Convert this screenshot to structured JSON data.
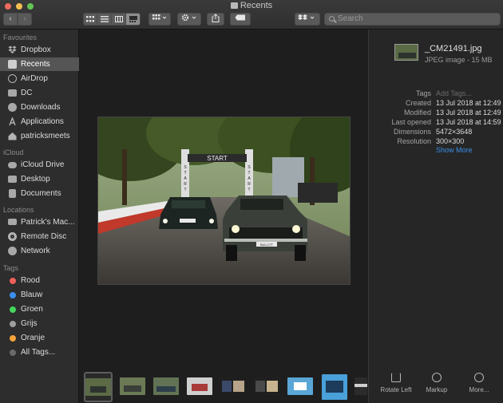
{
  "window": {
    "title": "Recents"
  },
  "toolbar": {
    "back_icon": "chevron-left-icon",
    "forward_icon": "chevron-right-icon",
    "view_modes": [
      "icon-view",
      "list-view",
      "column-view",
      "gallery-view"
    ],
    "selected_view": "gallery-view",
    "search_placeholder": "Search"
  },
  "sidebar": {
    "favourites_header": "Favourites",
    "favourites": [
      {
        "label": "Dropbox",
        "icon": "dropbox-icon"
      },
      {
        "label": "Recents",
        "icon": "clock-icon",
        "selected": true
      },
      {
        "label": "AirDrop",
        "icon": "airdrop-icon"
      },
      {
        "label": "DC",
        "icon": "folder-icon"
      },
      {
        "label": "Downloads",
        "icon": "download-icon"
      },
      {
        "label": "Applications",
        "icon": "applications-icon"
      },
      {
        "label": "patricksmeets",
        "icon": "home-icon"
      }
    ],
    "icloud_header": "iCloud",
    "icloud": [
      {
        "label": "iCloud Drive",
        "icon": "cloud-icon"
      },
      {
        "label": "Desktop",
        "icon": "desktop-icon"
      },
      {
        "label": "Documents",
        "icon": "document-icon"
      }
    ],
    "locations_header": "Locations",
    "locations": [
      {
        "label": "Patrick's Mac...",
        "icon": "laptop-icon"
      },
      {
        "label": "Remote Disc",
        "icon": "disc-icon"
      },
      {
        "label": "Network",
        "icon": "globe-icon"
      }
    ],
    "tags_header": "Tags",
    "tags": [
      {
        "label": "Rood",
        "color": "#f0605a"
      },
      {
        "label": "Blauw",
        "color": "#3b8ef0"
      },
      {
        "label": "Groen",
        "color": "#43d65c"
      },
      {
        "label": "Grijs",
        "color": "#9d9d9d"
      },
      {
        "label": "Oranje",
        "color": "#f5a33a"
      },
      {
        "label": "All Tags...",
        "color": "#6a6a6a"
      }
    ]
  },
  "inspector": {
    "file_name": "_CM21491.jpg",
    "file_kind": "JPEG image - 15 MB",
    "metadata": [
      {
        "key": "Tags",
        "value": "Add Tags...",
        "placeholder": true
      },
      {
        "key": "Created",
        "value": "13 Jul 2018 at 12:49"
      },
      {
        "key": "Modified",
        "value": "13 Jul 2018 at 12:49"
      },
      {
        "key": "Last opened",
        "value": "13 Jul 2018 at 14:59"
      },
      {
        "key": "Dimensions",
        "value": "5472×3648"
      },
      {
        "key": "Resolution",
        "value": "300×300"
      }
    ],
    "show_more": "Show More",
    "quick_actions": [
      {
        "label": "Rotate Left",
        "icon": "rotate-left-icon"
      },
      {
        "label": "Markup",
        "icon": "markup-icon"
      },
      {
        "label": "More...",
        "icon": "more-icon"
      }
    ]
  },
  "preview": {
    "banner_text": "START",
    "pillar_text": "START",
    "plate_text": "BULLITT"
  },
  "filmstrip": {
    "count": 9,
    "selected_index": 0
  }
}
